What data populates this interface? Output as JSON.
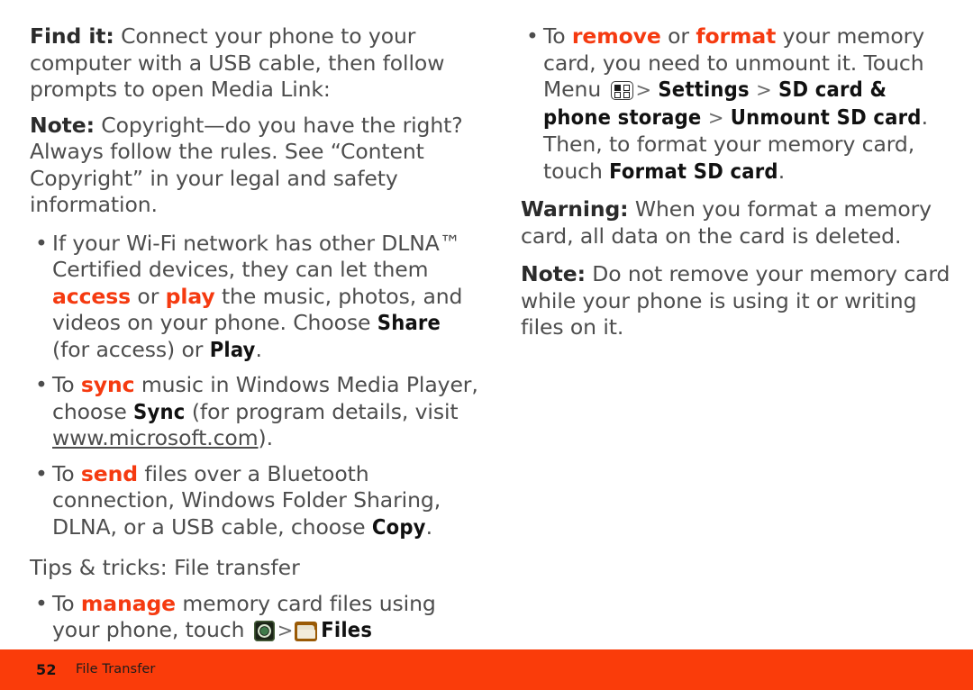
{
  "document": {
    "page_number": "52",
    "section_title": "File Transfer",
    "footer_color": "#fa3c0a",
    "accent_color": "#f53a10",
    "body_color": "#4d4d4d"
  },
  "left_column": {
    "find_it": {
      "lead": "Find it:",
      "text": " Connect your phone to your computer with a USB cable, then follow prompts to open Media Link:"
    },
    "note": {
      "lead": "Note:",
      "text": " Copyright—do you have the right? Always follow the rules. See “Content Copyright” in your legal and safety information."
    },
    "dlna_bullet": {
      "bullet": "•",
      "run_1": "If your Wi-Fi network has other DLNA™ Certified devices, they can let them ",
      "accent_1": "access",
      "run_2": " or ",
      "accent_2": "play",
      "run_3": " the music, photos, and videos on your phone. Choose ",
      "ui_1": "Share",
      "run_4": " (for access) or ",
      "ui_2": "Play",
      "run_5": "."
    },
    "sync_bullet": {
      "bullet": "•",
      "run_1": "To ",
      "accent_1": "sync",
      "run_2": " music in Windows Media Player, choose ",
      "ui_1": "Sync",
      "run_3": " (for program details, visit ",
      "link": "www.microsoft.com",
      "run_4": ")."
    },
    "send_bullet": {
      "bullet": "•",
      "run_1": "To ",
      "accent_1": "send",
      "run_2": " files over a Bluetooth connection, Windows Folder Sharing, DLNA, or a USB cable, choose ",
      "ui_1": "Copy",
      "run_3": "."
    },
    "tips_heading": "Tips & tricks: File transfer",
    "manage_bullet": {
      "bullet": "•",
      "run_1": "To ",
      "accent_1": "manage",
      "run_2": " memory card files using your phone, touch ",
      "icon_1": "apps-launcher-icon",
      "sep_1": ">",
      "icon_2": "folder-icon",
      "ui_1": "Files"
    }
  },
  "right_column": {
    "remove_bullet": {
      "bullet": "•",
      "run_1": "To ",
      "accent_1": "remove",
      "run_2": " or ",
      "accent_2": "format",
      "run_3": " your memory card, you need to unmount it. Touch Menu ",
      "icon_1": "menu-grid-icon",
      "sep_1": ">",
      "ui_1": "Settings",
      "sep_2": ">",
      "ui_2": "SD card & phone storage",
      "sep_3": ">",
      "ui_3": "Unmount SD card",
      "run_4": ". Then, to format your memory card, touch ",
      "ui_4": "Format SD card",
      "run_5": "."
    },
    "warning": {
      "lead": "Warning:",
      "text": " When you format a memory card, all data on the card is deleted."
    },
    "note": {
      "lead": "Note:",
      "text": " Do not remove your memory card while your phone is using it or writing files on it."
    }
  }
}
